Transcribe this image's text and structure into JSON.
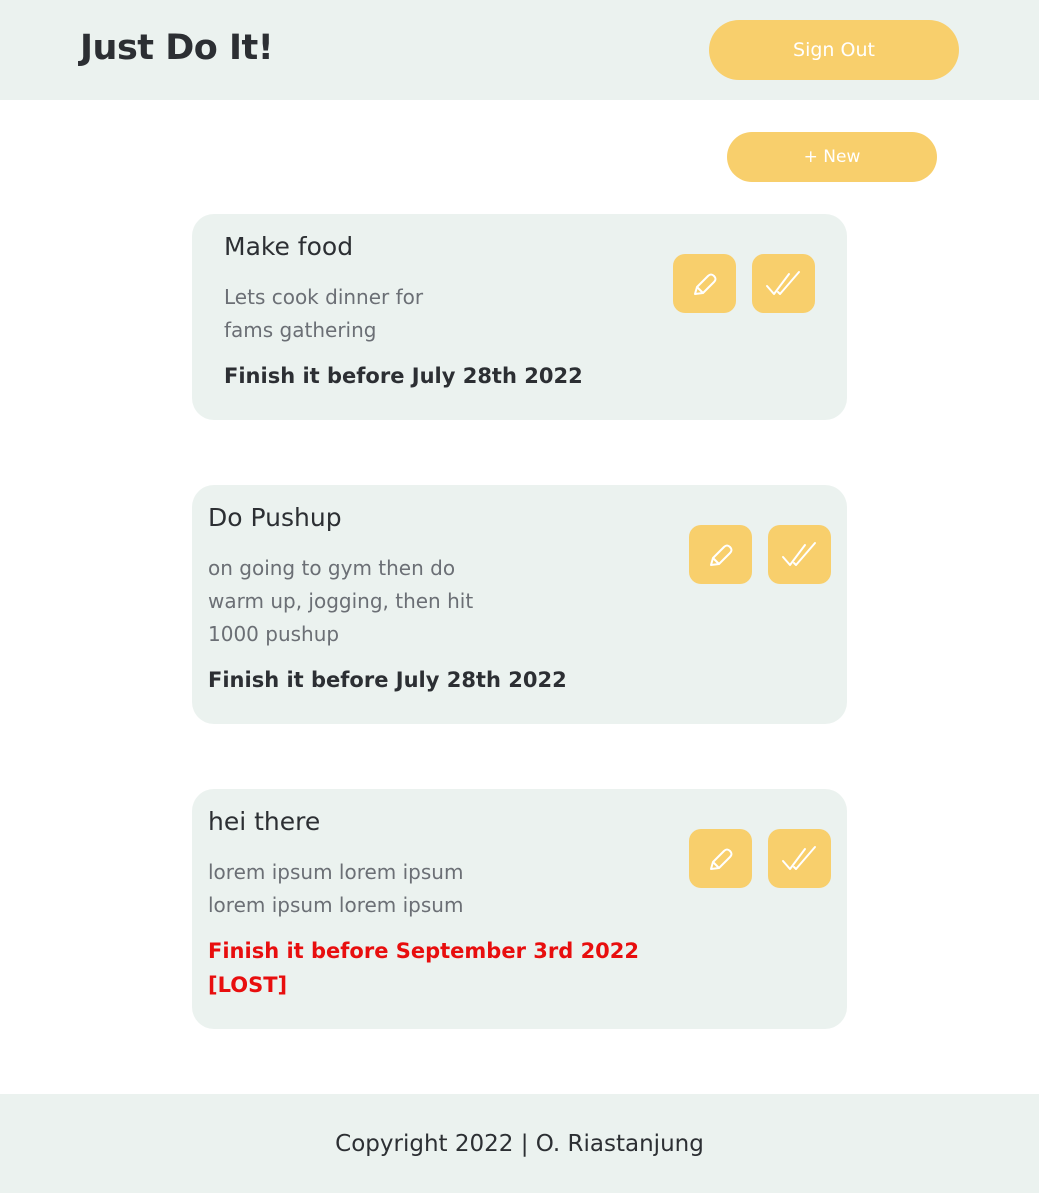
{
  "header": {
    "brand": "Just Do It!",
    "signout_label": "Sign Out"
  },
  "toolbar": {
    "new_label": "+ New"
  },
  "tasks": [
    {
      "title": "Make food",
      "description": "Lets cook dinner for fams gathering",
      "deadline": "Finish it before July 28th 2022",
      "lost": false
    },
    {
      "title": "Do Pushup",
      "description": "on going to gym then do warm up, jogging, then hit 1000 pushup",
      "deadline": "Finish it before July 28th 2022",
      "lost": false
    },
    {
      "title": "hei there",
      "description": "lorem ipsum lorem ipsum lorem ipsum lorem ipsum",
      "deadline": "Finish it before September 3rd 2022 [LOST]",
      "lost": true
    }
  ],
  "footer": {
    "copyright": "Copyright 2022 | O. Riastanjung"
  },
  "colors": {
    "accent": "#f8cf6c",
    "surface": "#ebf2ef",
    "lost": "#e80e0e"
  },
  "icons": {
    "edit": "pencil-icon",
    "done": "double-check-icon"
  }
}
